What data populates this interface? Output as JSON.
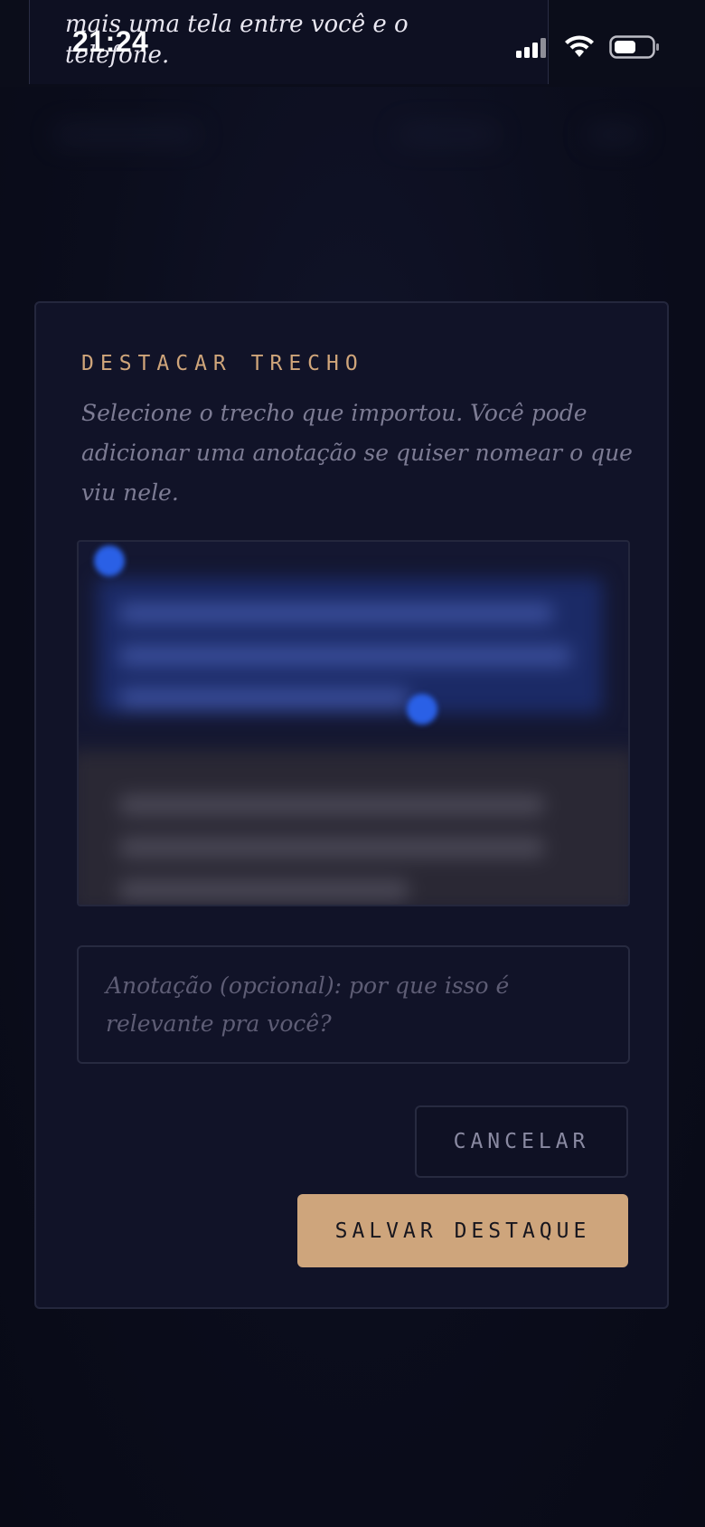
{
  "status_bar": {
    "time": "21:24",
    "overlap_text": "mais uma tela entre você e o telefone."
  },
  "modal": {
    "title": "DESTACAR TRECHO",
    "description": "Selecione o trecho que importou. Você pode adicionar uma anotação se quiser nomear o que viu nele.",
    "note_placeholder": "Anotação (opcional): por que isso é relevante pra você?",
    "cancel_label": "CANCELAR",
    "save_label": "SALVAR DESTAQUE"
  },
  "colors": {
    "accent": "#cea57c",
    "background": "#0a0c1a",
    "modal_bg": "#111328",
    "selection_handle": "#2a60e6"
  }
}
